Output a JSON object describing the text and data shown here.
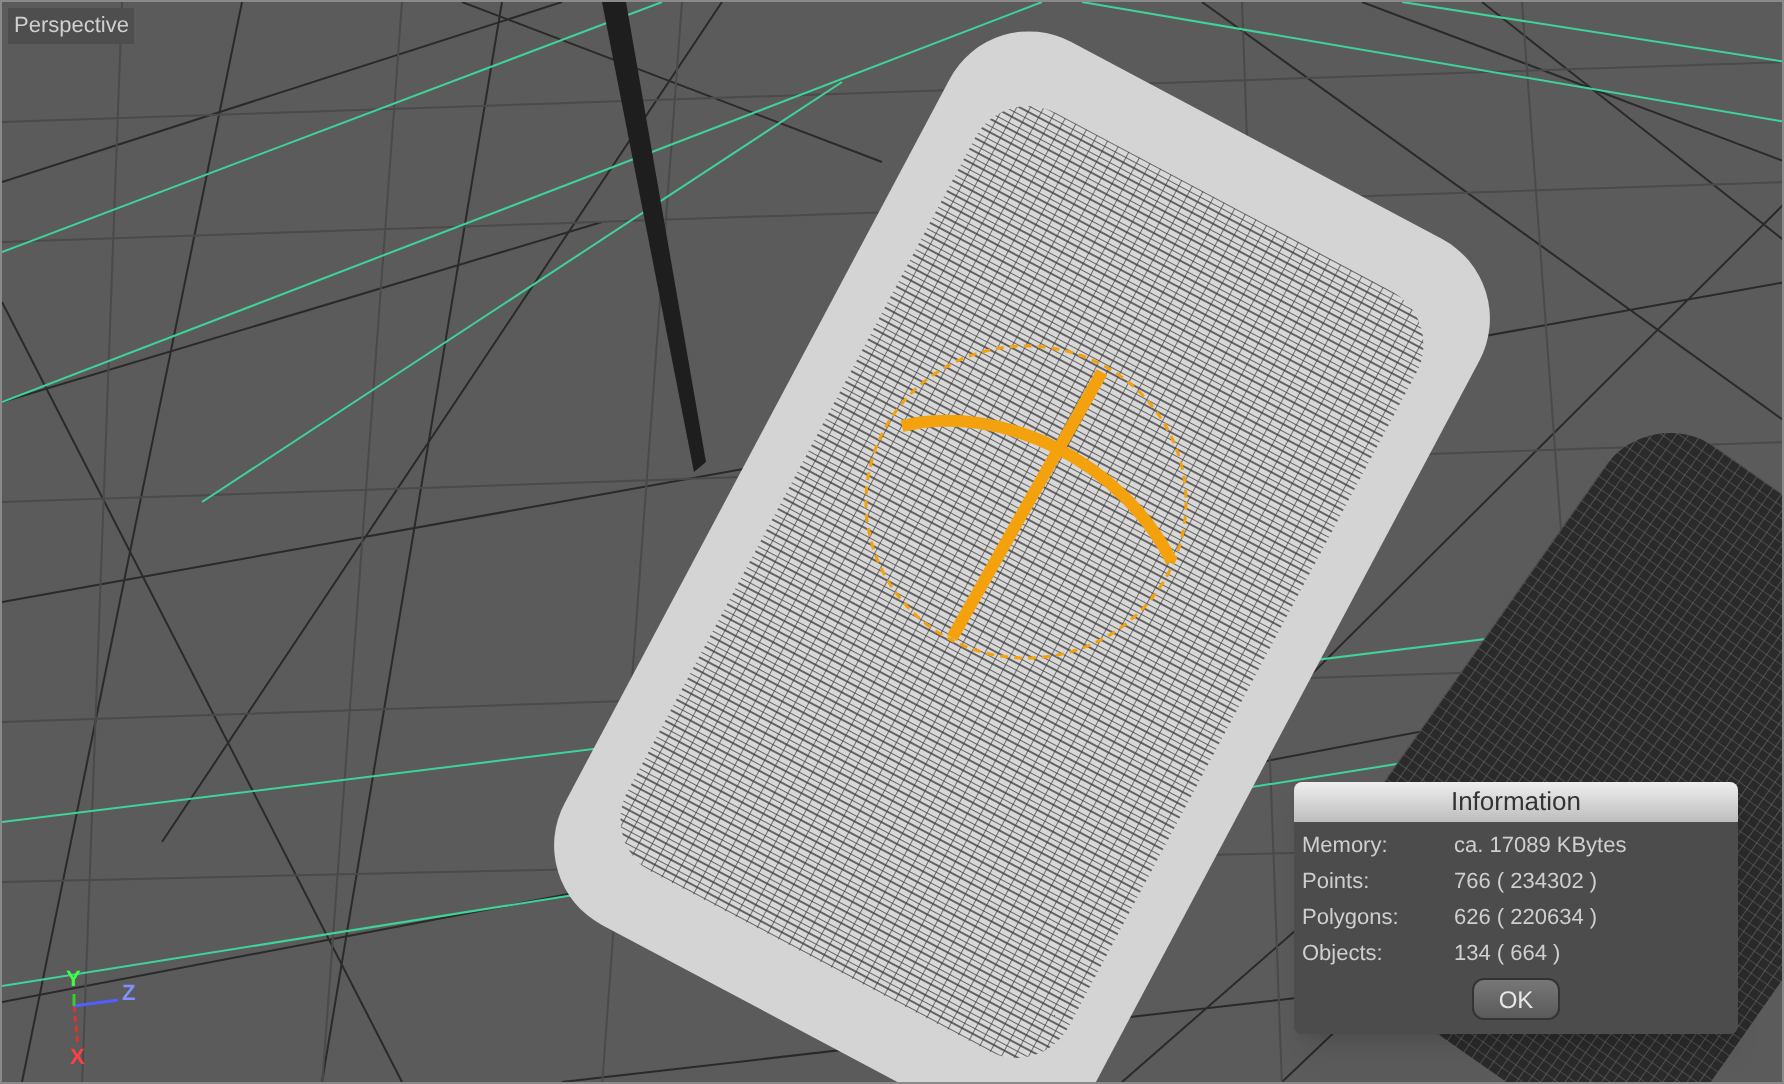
{
  "viewport": {
    "title": "Perspective",
    "axis_labels": [
      "Y",
      "Z",
      "X"
    ]
  },
  "dialog": {
    "title": "Information",
    "rows": [
      {
        "label": "Memory:",
        "value": "ca. 17089 KBytes"
      },
      {
        "label": "Points:",
        "value": "766 ( 234302 )"
      },
      {
        "label": "Polygons:",
        "value": "626 ( 220634 )"
      },
      {
        "label": "Objects:",
        "value": "134 ( 664 )"
      }
    ],
    "button": "OK"
  }
}
